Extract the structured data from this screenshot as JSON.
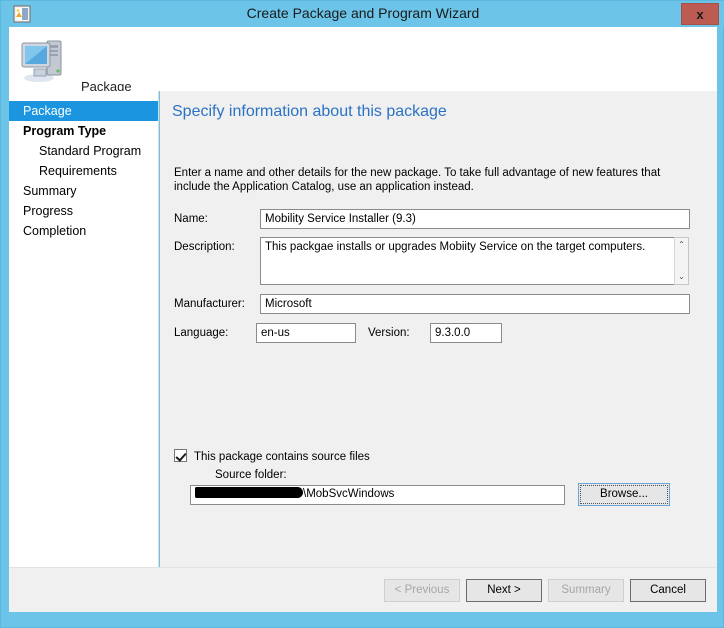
{
  "window": {
    "title": "Create Package and Program Wizard",
    "title_icon": "package-wizard-icon",
    "close_label": "x",
    "frame_color": "#6cc5e8"
  },
  "banner": {
    "icon": "computer-icon",
    "label": "Package"
  },
  "sidebar": {
    "items": [
      {
        "label": "Package",
        "selected": true,
        "bold": false,
        "sub": false
      },
      {
        "label": "Program Type",
        "selected": false,
        "bold": true,
        "sub": false
      },
      {
        "label": "Standard Program",
        "selected": false,
        "bold": false,
        "sub": true
      },
      {
        "label": "Requirements",
        "selected": false,
        "bold": false,
        "sub": true
      },
      {
        "label": "Summary",
        "selected": false,
        "bold": false,
        "sub": false
      },
      {
        "label": "Progress",
        "selected": false,
        "bold": false,
        "sub": false
      },
      {
        "label": "Completion",
        "selected": false,
        "bold": false,
        "sub": false
      }
    ],
    "selected_color": "#1b95e0"
  },
  "content": {
    "heading": "Specify information about this package",
    "heading_color": "#2a72c4",
    "intro": "Enter a name and other details for the new package. To take full advantage of new features that include the Application Catalog, use an application instead.",
    "fields": {
      "name_label": "Name:",
      "name_value": "Mobility Service Installer (9.3)",
      "description_label": "Description:",
      "description_value": "This packgae installs or upgrades Mobiity Service on the target computers.",
      "manufacturer_label": "Manufacturer:",
      "manufacturer_value": "Microsoft",
      "language_label": "Language:",
      "language_value": "en-us",
      "version_label": "Version:",
      "version_value": "9.3.0.0"
    },
    "source": {
      "checkbox_label": "This package contains source files",
      "checkbox_checked": true,
      "folder_label": "Source folder:",
      "folder_value_redacted": true,
      "folder_value_visible": "\\MobSvcWindows",
      "browse_label": "Browse..."
    },
    "scrollbar": {
      "up_arrow": "⌃",
      "down_arrow": "⌄"
    }
  },
  "footer": {
    "buttons": [
      {
        "label": "< Previous",
        "enabled": false
      },
      {
        "label": "Next >",
        "enabled": true
      },
      {
        "label": "Summary",
        "enabled": false
      },
      {
        "label": "Cancel",
        "enabled": true
      }
    ]
  }
}
